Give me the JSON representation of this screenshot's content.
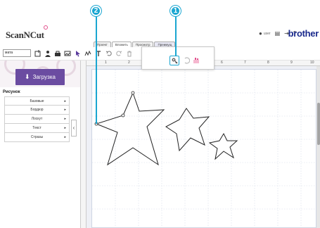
{
  "app": {
    "logo_text": "ScanNCut",
    "brand": "brother"
  },
  "header": {
    "user_name": "user",
    "icons": [
      "user-icon",
      "notes-icon",
      "logout-icon",
      "help-icon"
    ]
  },
  "tabs": [
    {
      "label": "Проект"
    },
    {
      "label": "Вложить"
    },
    {
      "label": "Просмотр"
    },
    {
      "label": "Преимущ"
    }
  ],
  "toolbar": {
    "mat_value": "мата",
    "icons": [
      "add-icon",
      "person-icon",
      "bag-icon",
      "image-icon",
      "select-icon",
      "draw-icon",
      "text-icon",
      "undo-icon",
      "redo-icon",
      "delete-icon"
    ]
  },
  "popup": {
    "buttons": [
      "point-edit-icon",
      "rotate-icon",
      "weld-icon"
    ]
  },
  "callouts": {
    "one": "1",
    "two": "2"
  },
  "sidebar": {
    "upload_label": "Загрузка",
    "section_title": "Рисунок",
    "items": [
      {
        "label": "Базовые"
      },
      {
        "label": "Бордюр"
      },
      {
        "label": "Лоскут"
      },
      {
        "label": "Текст"
      },
      {
        "label": "Стразы"
      }
    ]
  },
  "canvas": {
    "ruler_numbers": [
      "1",
      "2",
      "3",
      "4",
      "5",
      "6",
      "7",
      "8",
      "9",
      "10"
    ]
  },
  "colors": {
    "accent": "#1aa6d1",
    "upload_button": "#6b4ca1",
    "brand": "#1a2a8c",
    "pink": "#e24f8c"
  }
}
